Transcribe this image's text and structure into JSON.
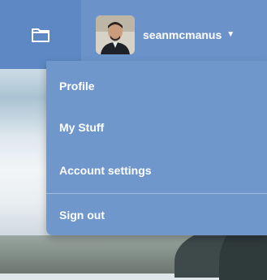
{
  "header": {
    "folder_icon": "folder-icon",
    "user": {
      "name": "seanmcmanus",
      "avatar_icon": "user-avatar",
      "caret_icon": "chevron-down-icon"
    }
  },
  "menu": {
    "items": [
      {
        "label": "Profile"
      },
      {
        "label": "My Stuff"
      },
      {
        "label": "Account settings"
      },
      {
        "label": "Sign out"
      }
    ]
  },
  "colors": {
    "header_bg": "#6b93c9",
    "menu_bg": "#6f97cb",
    "text": "#ffffff"
  }
}
